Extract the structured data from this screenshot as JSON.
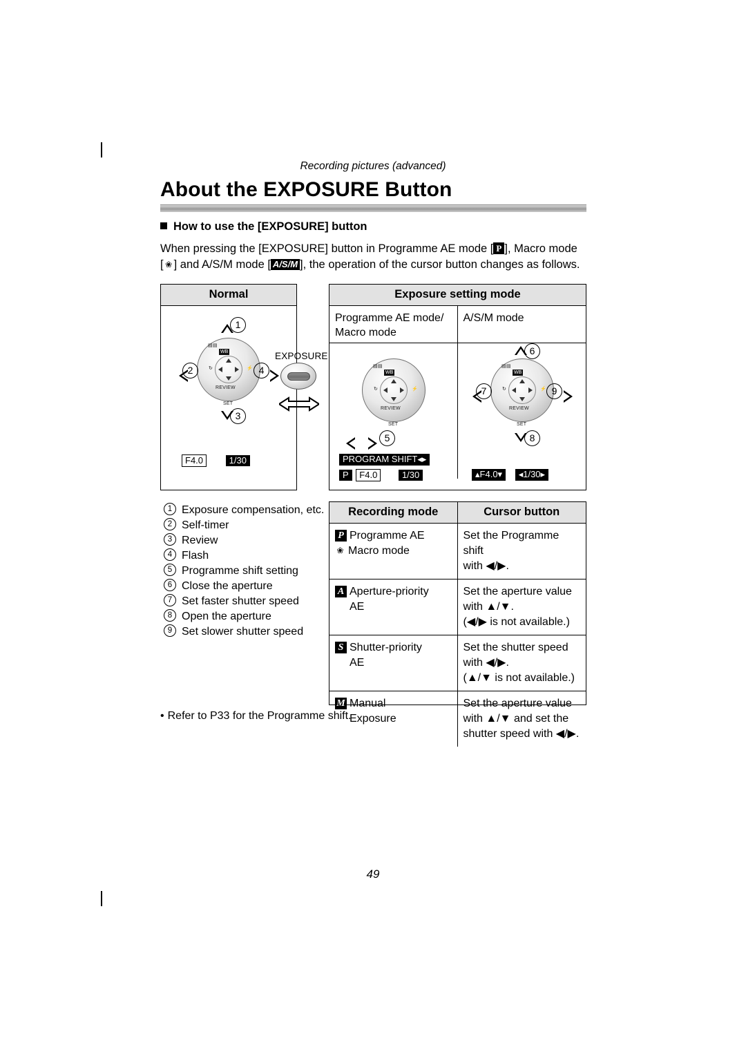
{
  "page": {
    "header_note": "Recording pictures (advanced)",
    "title": "About the EXPOSURE Button",
    "sub_head": "How to use the [EXPOSURE] button",
    "page_number": "49",
    "refer_note": "Refer to P33 for the Programme shift.",
    "bullet": "•"
  },
  "paragraph": {
    "part1": "When pressing the [EXPOSURE] button in Programme AE mode [",
    "glyph_p": "P",
    "part2": "], Macro mode",
    "part3": "[",
    "glyph_macro": "❀",
    "part4": "] and A/S/M mode [",
    "glyph_asm": "A/S/M",
    "part5": "], the operation of the cursor button changes as follows."
  },
  "normal_panel": {
    "title": "Normal",
    "callouts": [
      "1",
      "2",
      "3",
      "4"
    ],
    "readout_aperture": "F4.0",
    "readout_shutter": "1/30"
  },
  "exposure_panel": {
    "title": "Exposure setting mode",
    "col1_line1": "Programme AE mode/",
    "col1_line2": "Macro mode",
    "col2_line1": "A/S/M mode",
    "left_callouts": [
      "5"
    ],
    "right_callouts": [
      "6",
      "7",
      "8",
      "9"
    ],
    "left_readout_label": "PROGRAM SHIFT",
    "left_readout_mode": "P",
    "left_readout_aperture": "F4.0",
    "left_readout_shutter": "1/30",
    "right_readout_aperture": "F4.0",
    "right_readout_shutter": "1/30"
  },
  "exposure_button": {
    "label": "EXPOSURE"
  },
  "dial": {
    "label_set": "SET",
    "label_review": "REVIEW",
    "label_wb": "WB",
    "label_exp": "±",
    "label_timer": "↺",
    "label_flash": "⚡"
  },
  "legend": [
    {
      "num": "1",
      "text": "Exposure compensation, etc."
    },
    {
      "num": "2",
      "text": "Self-timer"
    },
    {
      "num": "3",
      "text": "Review"
    },
    {
      "num": "4",
      "text": "Flash"
    },
    {
      "num": "5",
      "text": "Programme shift setting"
    },
    {
      "num": "6",
      "text": "Close the aperture"
    },
    {
      "num": "7",
      "text": "Set faster shutter speed"
    },
    {
      "num": "8",
      "text": "Open the aperture"
    },
    {
      "num": "9",
      "text": "Set slower shutter speed"
    }
  ],
  "recording_table": {
    "headers": [
      "Recording mode",
      "Cursor button"
    ],
    "rows": [
      {
        "badge": "P",
        "mode_line1": "Programme AE",
        "mode_icon": "❀",
        "mode_line2": "Macro mode",
        "cursor_line1": "Set the Programme shift",
        "cursor_line2": "with ◀/▶.",
        "cursor_line3": ""
      },
      {
        "badge": "A",
        "mode_line1": "Aperture-priority",
        "mode_line2": "AE",
        "cursor_line1": "Set the aperture value",
        "cursor_line2": "with ▲/▼.",
        "cursor_line3": "(◀/▶ is not available.)"
      },
      {
        "badge": "S",
        "mode_line1": "Shutter-priority",
        "mode_line2": "AE",
        "cursor_line1": "Set the shutter speed",
        "cursor_line2": "with ◀/▶.",
        "cursor_line3": "(▲/▼ is not available.)"
      },
      {
        "badge": "M",
        "mode_line1": "Manual",
        "mode_line2": "Exposure",
        "cursor_line1": "Set the aperture value",
        "cursor_line2": "with ▲/▼ and set the",
        "cursor_line3": "shutter speed with ◀/▶."
      }
    ]
  }
}
